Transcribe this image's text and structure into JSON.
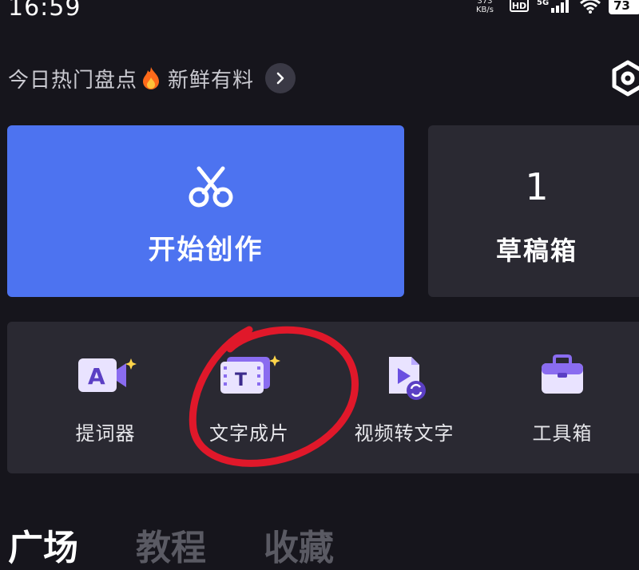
{
  "status_bar": {
    "time": "16:59",
    "net_speed_value": "373",
    "net_speed_unit": "KB/s",
    "hd": "HD",
    "battery": "73"
  },
  "header": {
    "hot_text": "今日热门盘点",
    "hot_icon": "fire-icon",
    "fresh_text": "新鲜有料",
    "arrow_icon": "chevron-right-icon",
    "settings_icon": "settings-icon"
  },
  "create_card": {
    "icon": "scissors-icon",
    "label": "开始创作",
    "color": "#4d73f0"
  },
  "draft_card": {
    "count": "1",
    "label": "草稿箱"
  },
  "tools": [
    {
      "icon": "teleprompter-icon",
      "label": "提词器"
    },
    {
      "icon": "text-to-video-icon",
      "label": "文字成片"
    },
    {
      "icon": "video-to-text-icon",
      "label": "视频转文字"
    },
    {
      "icon": "toolbox-icon",
      "label": "工具箱"
    }
  ],
  "tabs": [
    {
      "label": "广场",
      "active": true
    },
    {
      "label": "教程",
      "active": false
    },
    {
      "label": "收藏",
      "active": false
    }
  ],
  "colors": {
    "background": "#16151c",
    "card": "#2a2932",
    "annotation": "#e0182a"
  }
}
